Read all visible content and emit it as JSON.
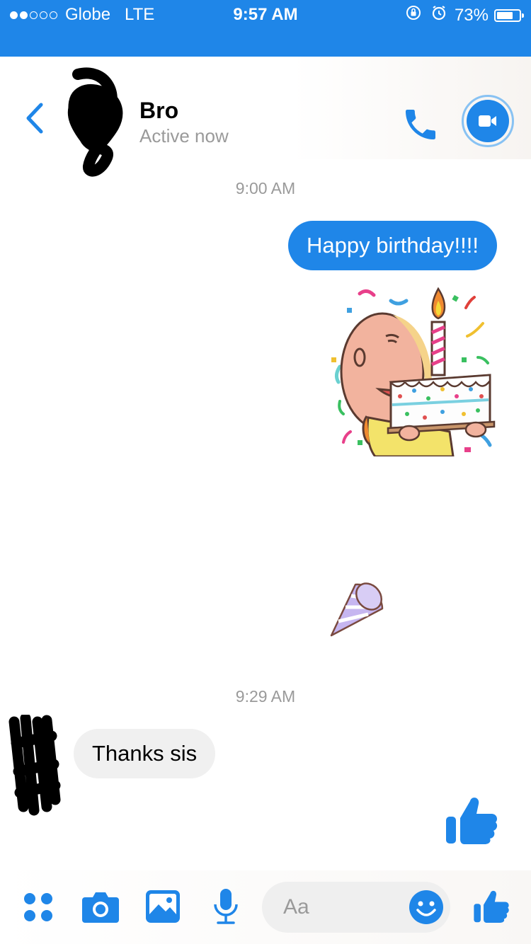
{
  "status_bar": {
    "signal_dots_filled": 2,
    "signal_dots_total": 5,
    "carrier": "Globe",
    "network": "LTE",
    "time": "9:57 AM",
    "battery": "73%",
    "battery_level": 0.73
  },
  "header": {
    "contact_name": "Bro",
    "presence": "Active now"
  },
  "messages": {
    "timestamp_1": "9:00 AM",
    "sent_text": "Happy birthday!!!!",
    "timestamp_2": "9:29 AM",
    "received_text": "Thanks sis"
  },
  "composer": {
    "placeholder": "Aa"
  },
  "colors": {
    "accent": "#1f86e8",
    "received_bubble": "#f0f0f0",
    "secondary_text": "#9a9a9a"
  }
}
